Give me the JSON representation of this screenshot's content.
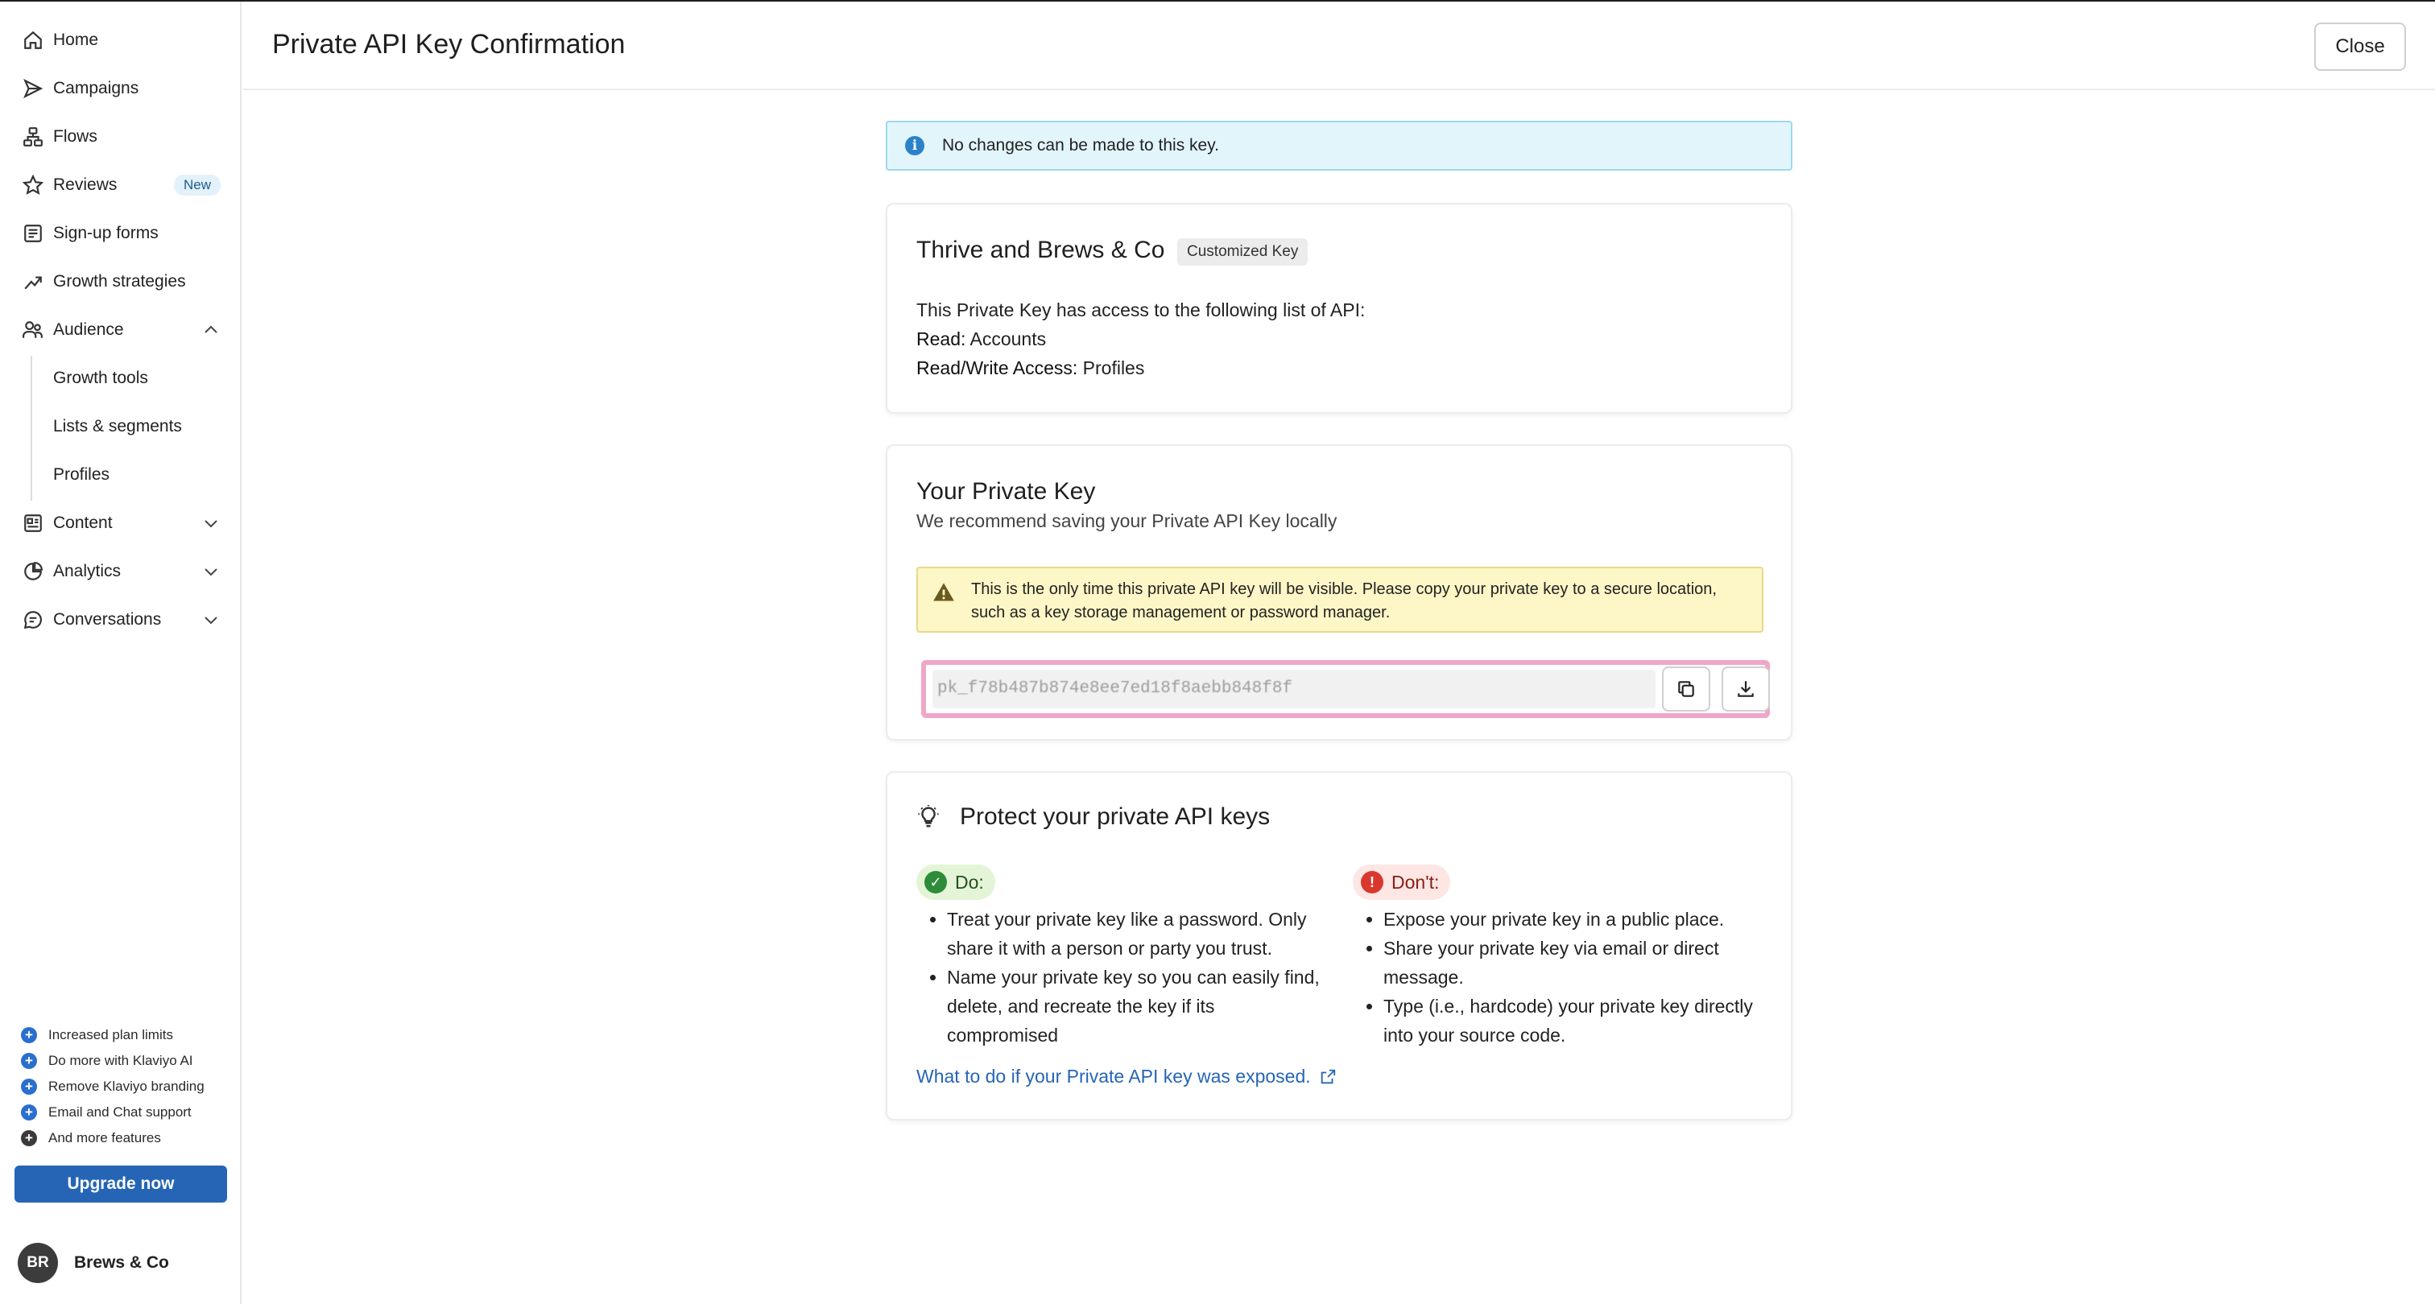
{
  "sidebar": {
    "items": [
      {
        "label": "Home",
        "icon": "home-icon"
      },
      {
        "label": "Campaigns",
        "icon": "send-icon"
      },
      {
        "label": "Flows",
        "icon": "flows-icon"
      },
      {
        "label": "Reviews",
        "icon": "star-icon",
        "badge": "New"
      },
      {
        "label": "Sign-up forms",
        "icon": "form-icon"
      },
      {
        "label": "Growth strategies",
        "icon": "trend-icon"
      },
      {
        "label": "Audience",
        "icon": "audience-icon",
        "expanded": true
      },
      {
        "label": "Content",
        "icon": "content-icon"
      },
      {
        "label": "Analytics",
        "icon": "analytics-icon"
      },
      {
        "label": "Conversations",
        "icon": "chat-icon"
      }
    ],
    "audience_sub": [
      "Growth tools",
      "Lists & segments",
      "Profiles"
    ],
    "perks": [
      "Increased plan limits",
      "Do more with Klaviyo AI",
      "Remove Klaviyo branding",
      "Email and Chat support",
      "And more features"
    ],
    "upgrade_label": "Upgrade now",
    "account": {
      "initials": "BR",
      "name": "Brews & Co"
    }
  },
  "header": {
    "title": "Private API Key Confirmation",
    "close_label": "Close"
  },
  "info_banner": "No changes can be made to this key.",
  "key_card": {
    "name": "Thrive and Brews & Co",
    "tag": "Customized Key",
    "intro": "This Private Key has access to the following list of API:",
    "read_label": "Read:",
    "read_value": "Accounts",
    "rw_label": "Read/Write Access:",
    "rw_value": "Profiles"
  },
  "private_key": {
    "title": "Your Private Key",
    "subtitle": "We recommend saving your Private API Key locally",
    "warning": "This is the only time this private API key will be visible. Please copy your private key to a secure location, such as a key storage management or password manager.",
    "value": "pk_f78b487b874e8ee7ed18f8aebb848f8f"
  },
  "protect": {
    "title": "Protect your private API keys",
    "do_label": "Do:",
    "dont_label": "Don't:",
    "do_items": [
      "Treat your private key like a password. Only share it with a person or party you trust.",
      "Name your private key so you can easily find, delete, and recreate the key if its compromised"
    ],
    "dont_items": [
      "Expose your private key in a public place.",
      "Share your private key via email or direct message.",
      "Type (i.e., hardcode) your private key directly into your source code."
    ],
    "link": "What to do if your Private API key was exposed."
  },
  "colors": {
    "primary": "#2665b5",
    "info_bg": "#e2f5fb",
    "warn_bg": "#fdf6c6",
    "key_highlight": "#f0a6c8"
  }
}
